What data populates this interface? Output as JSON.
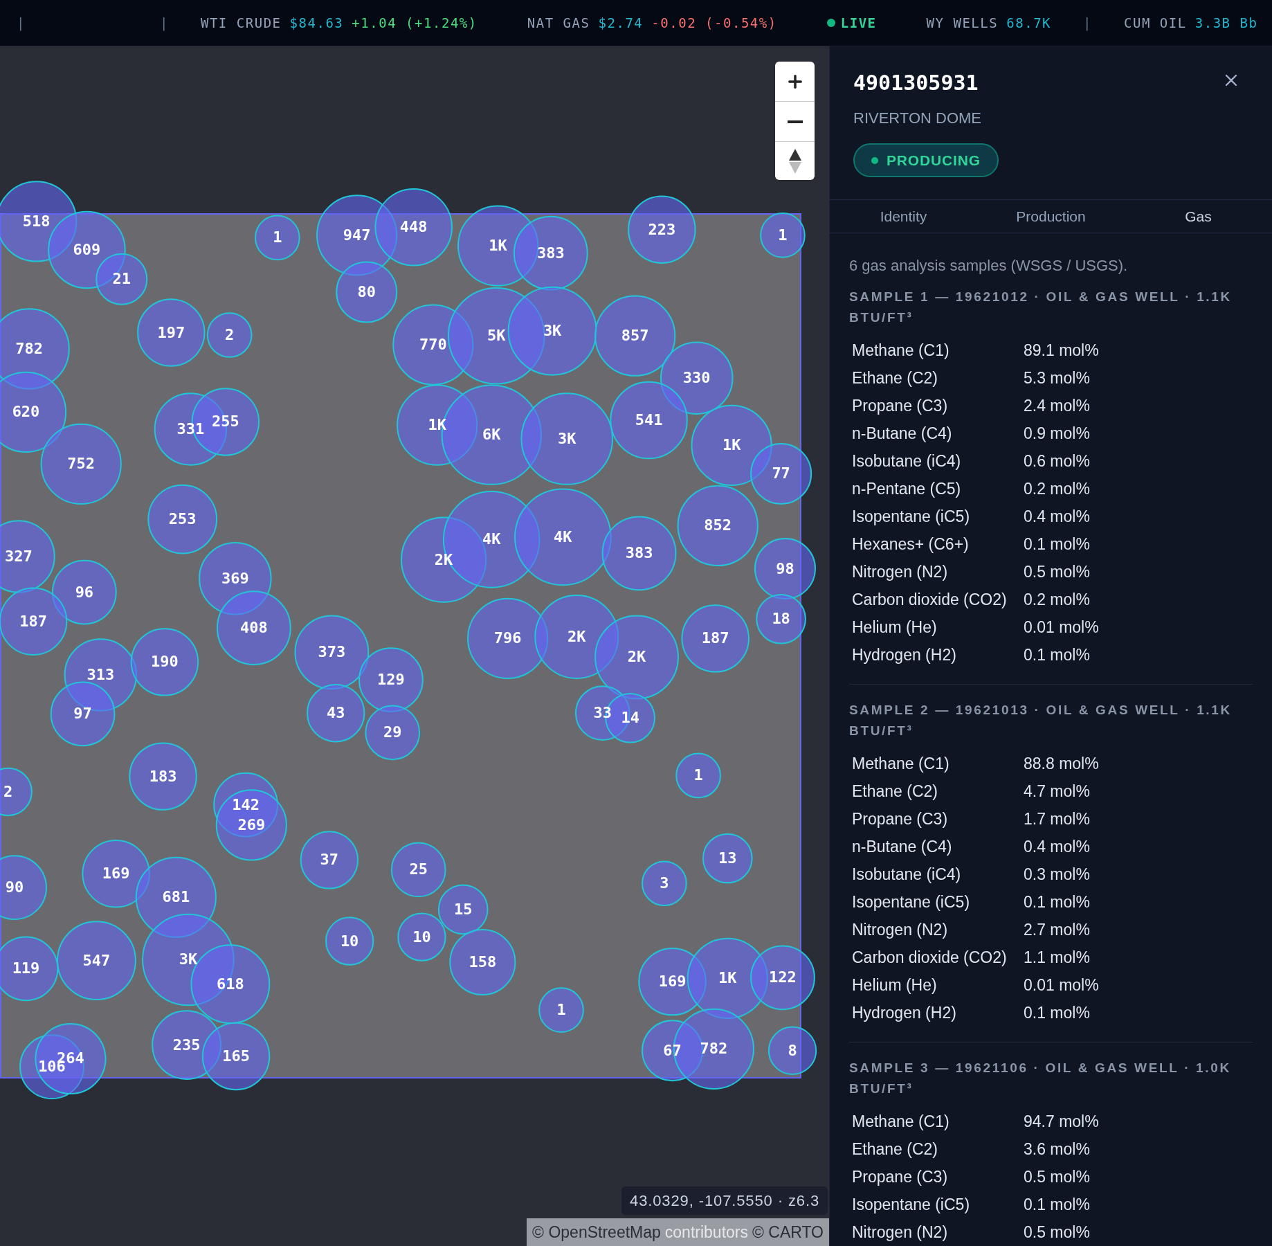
{
  "ticker": [
    {
      "kind": "sep",
      "text": "|"
    },
    {
      "kind": "sep",
      "text": "|"
    },
    {
      "kind": "gain",
      "label": "WTI CRUDE",
      "value": "$84.63",
      "change": "+1.04",
      "pct": "(+1.24%)"
    },
    {
      "kind": "loss",
      "label": "NAT GAS",
      "value": "$2.74",
      "change": "-0.02",
      "pct": "(-0.54%)"
    },
    {
      "kind": "live",
      "label": "LIVE"
    },
    {
      "kind": "stat",
      "label": "WY WELLS",
      "value": "68.7K"
    },
    {
      "kind": "sep",
      "text": "|"
    },
    {
      "kind": "stat",
      "label": "CUM OIL",
      "value": "3.3B Bb"
    }
  ],
  "map": {
    "clusters": [
      {
        "label": "518"
      },
      {
        "label": "609"
      },
      {
        "label": "21"
      },
      {
        "label": "1"
      },
      {
        "label": "947"
      },
      {
        "label": "448"
      },
      {
        "label": "80"
      },
      {
        "label": "1K"
      },
      {
        "label": "383"
      },
      {
        "label": "223"
      },
      {
        "label": "1"
      },
      {
        "label": "782"
      },
      {
        "label": "197"
      },
      {
        "label": "2"
      },
      {
        "label": "770"
      },
      {
        "label": "5K"
      },
      {
        "label": "3K"
      },
      {
        "label": "857"
      },
      {
        "label": "330"
      },
      {
        "label": "620"
      },
      {
        "label": "331"
      },
      {
        "label": "255"
      },
      {
        "label": "1K"
      },
      {
        "label": "6K"
      },
      {
        "label": "3K"
      },
      {
        "label": "541"
      },
      {
        "label": "1K"
      },
      {
        "label": "77"
      },
      {
        "label": "752"
      },
      {
        "label": "253"
      },
      {
        "label": "852"
      },
      {
        "label": "327"
      },
      {
        "label": "96"
      },
      {
        "label": "369"
      },
      {
        "label": "2K"
      },
      {
        "label": "4K"
      },
      {
        "label": "4K"
      },
      {
        "label": "383"
      },
      {
        "label": "98"
      },
      {
        "label": "187"
      },
      {
        "label": "408"
      },
      {
        "label": "18"
      },
      {
        "label": "373"
      },
      {
        "label": "796"
      },
      {
        "label": "2K"
      },
      {
        "label": "2K"
      },
      {
        "label": "187"
      },
      {
        "label": "313"
      },
      {
        "label": "190"
      },
      {
        "label": "129"
      },
      {
        "label": "97"
      },
      {
        "label": "43"
      },
      {
        "label": "29"
      },
      {
        "label": "33"
      },
      {
        "label": "14"
      },
      {
        "label": "1"
      },
      {
        "label": "183"
      },
      {
        "label": "2"
      },
      {
        "label": "142"
      },
      {
        "label": "269"
      },
      {
        "label": "37"
      },
      {
        "label": "25"
      },
      {
        "label": "13"
      },
      {
        "label": "90"
      },
      {
        "label": "169"
      },
      {
        "label": "681"
      },
      {
        "label": "3"
      },
      {
        "label": "15"
      },
      {
        "label": "10"
      },
      {
        "label": "10"
      },
      {
        "label": "158"
      },
      {
        "label": "119"
      },
      {
        "label": "547"
      },
      {
        "label": "3K"
      },
      {
        "label": "618"
      },
      {
        "label": "169"
      },
      {
        "label": "1K"
      },
      {
        "label": "122"
      },
      {
        "label": "1"
      },
      {
        "label": "235"
      },
      {
        "label": "165"
      },
      {
        "label": "106"
      },
      {
        "label": "264"
      },
      {
        "label": "67"
      },
      {
        "label": "782"
      },
      {
        "label": "8"
      }
    ],
    "coordinates": "43.0329, -107.5550 · z6.3",
    "attribution": [
      {
        "kind": "link",
        "text": "© OpenStreetMap"
      },
      {
        "kind": "text",
        "text": "contributors"
      },
      {
        "kind": "link",
        "text": "© CARTO"
      }
    ]
  },
  "panel": {
    "title": "4901305931",
    "subtitle": "RIVERTON DOME",
    "status": {
      "label": "PRODUCING",
      "kind": "producing"
    },
    "tabs": [
      {
        "label": "Identity",
        "selected": false
      },
      {
        "label": "Production",
        "selected": false
      },
      {
        "label": "Gas",
        "selected": true
      }
    ],
    "summary": "6 gas analysis samples (WSGS / USGS).",
    "samples": [
      {
        "header": "SAMPLE 1 — 19621012 · OIL & GAS WELL · 1.1K BTU/FT³",
        "rows": [
          {
            "name": "Methane (C1)",
            "value": "89.1 mol%"
          },
          {
            "name": "Ethane (C2)",
            "value": "5.3 mol%"
          },
          {
            "name": "Propane (C3)",
            "value": "2.4 mol%"
          },
          {
            "name": "n-Butane (C4)",
            "value": "0.9 mol%"
          },
          {
            "name": "Isobutane (iC4)",
            "value": "0.6 mol%"
          },
          {
            "name": "n-Pentane (C5)",
            "value": "0.2 mol%"
          },
          {
            "name": "Isopentane (iC5)",
            "value": "0.4 mol%"
          },
          {
            "name": "Hexanes+ (C6+)",
            "value": "0.1 mol%"
          },
          {
            "name": "Nitrogen (N2)",
            "value": "0.5 mol%"
          },
          {
            "name": "Carbon dioxide (CO2)",
            "value": "0.2 mol%"
          },
          {
            "name": "Helium (He)",
            "value": "0.01 mol%"
          },
          {
            "name": "Hydrogen (H2)",
            "value": "0.1 mol%"
          }
        ]
      },
      {
        "header": "SAMPLE 2 — 19621013 · OIL & GAS WELL · 1.1K BTU/FT³",
        "rows": [
          {
            "name": "Methane (C1)",
            "value": "88.8 mol%"
          },
          {
            "name": "Ethane (C2)",
            "value": "4.7 mol%"
          },
          {
            "name": "Propane (C3)",
            "value": "1.7 mol%"
          },
          {
            "name": "n-Butane (C4)",
            "value": "0.4 mol%"
          },
          {
            "name": "Isobutane (iC4)",
            "value": "0.3 mol%"
          },
          {
            "name": "Isopentane (iC5)",
            "value": "0.1 mol%"
          },
          {
            "name": "Nitrogen (N2)",
            "value": "2.7 mol%"
          },
          {
            "name": "Carbon dioxide (CO2)",
            "value": "1.1 mol%"
          },
          {
            "name": "Helium (He)",
            "value": "0.01 mol%"
          },
          {
            "name": "Hydrogen (H2)",
            "value": "0.1 mol%"
          }
        ]
      },
      {
        "header": "SAMPLE 3 — 19621106 · OIL & GAS WELL · 1.0K BTU/FT³",
        "rows": [
          {
            "name": "Methane (C1)",
            "value": "94.7 mol%"
          },
          {
            "name": "Ethane (C2)",
            "value": "3.6 mol%"
          },
          {
            "name": "Propane (C3)",
            "value": "0.5 mol%"
          },
          {
            "name": "Isopentane (iC5)",
            "value": "0.1 mol%"
          },
          {
            "name": "Nitrogen (N2)",
            "value": "0.5 mol%"
          }
        ]
      }
    ]
  }
}
